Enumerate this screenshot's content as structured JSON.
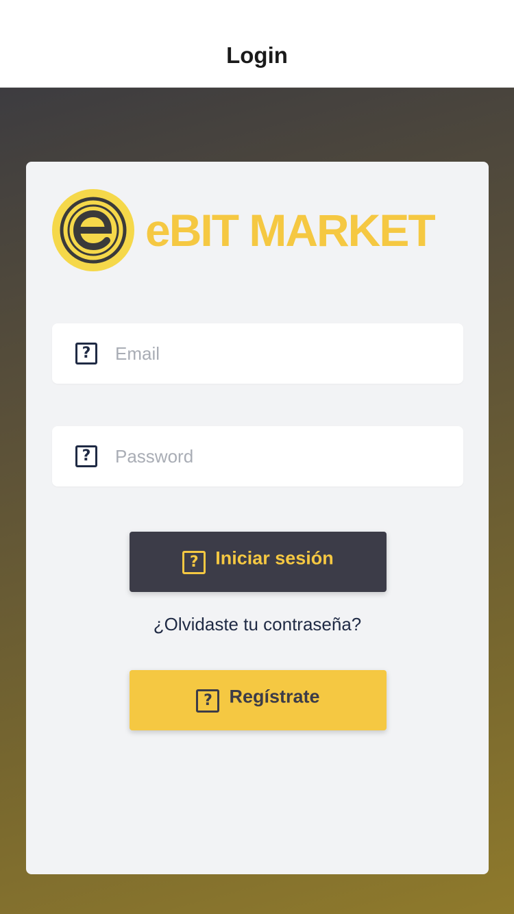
{
  "nav": {
    "title": "Login"
  },
  "logo": {
    "text": "eBIT MARKET",
    "emblem_letter": "e",
    "icon": "ebit-market-logo"
  },
  "form": {
    "email": {
      "placeholder": "Email",
      "value": "",
      "icon": "question-box-icon"
    },
    "password": {
      "placeholder": "Password",
      "value": "",
      "icon": "question-box-icon"
    },
    "login_button": {
      "label": "Iniciar sesión",
      "icon": "question-box-icon"
    },
    "forgot_link": "¿Olvidaste tu contraseña?",
    "register_button": {
      "label": "Regístrate",
      "icon": "question-box-icon"
    },
    "icon_glyph": "?"
  },
  "colors": {
    "accent_yellow": "#f5c842",
    "dark_button": "#3c3c48",
    "card_bg": "#f2f3f5",
    "text_navy": "#1f2a44"
  }
}
